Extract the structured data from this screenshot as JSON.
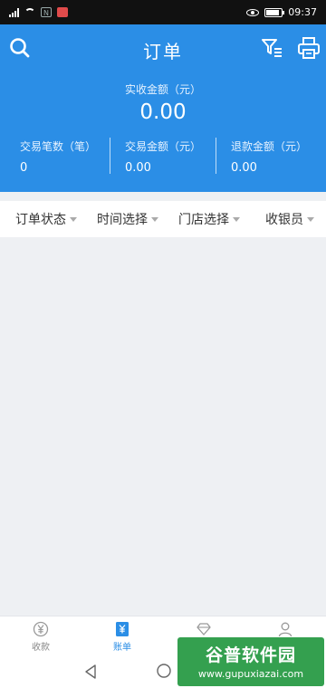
{
  "status_bar": {
    "time": "09:37",
    "nfc_label": "N"
  },
  "header": {
    "title": "订单",
    "summary_label": "实收金额（元）",
    "summary_value": "0.00",
    "stats": [
      {
        "label": "交易笔数（笔）",
        "value": "0"
      },
      {
        "label": "交易金额（元）",
        "value": "0.00"
      },
      {
        "label": "退款金额（元）",
        "value": "0.00"
      }
    ]
  },
  "filters": [
    {
      "label": "订单状态"
    },
    {
      "label": "时间选择"
    },
    {
      "label": "门店选择"
    },
    {
      "label": "收银员"
    }
  ],
  "bottom_nav": [
    {
      "label": "收款",
      "icon": "yuan-circle-icon"
    },
    {
      "label": "账单",
      "icon": "bill-icon",
      "active": true
    },
    {
      "label": "",
      "icon": "diamond-icon"
    },
    {
      "label": "",
      "icon": "person-icon"
    }
  ],
  "watermark": {
    "title": "谷普软件园",
    "url": "www.gupuxiazai.com"
  },
  "colors": {
    "primary": "#2b8ee6",
    "background": "#eef0f3",
    "watermark": "#1e963c"
  }
}
